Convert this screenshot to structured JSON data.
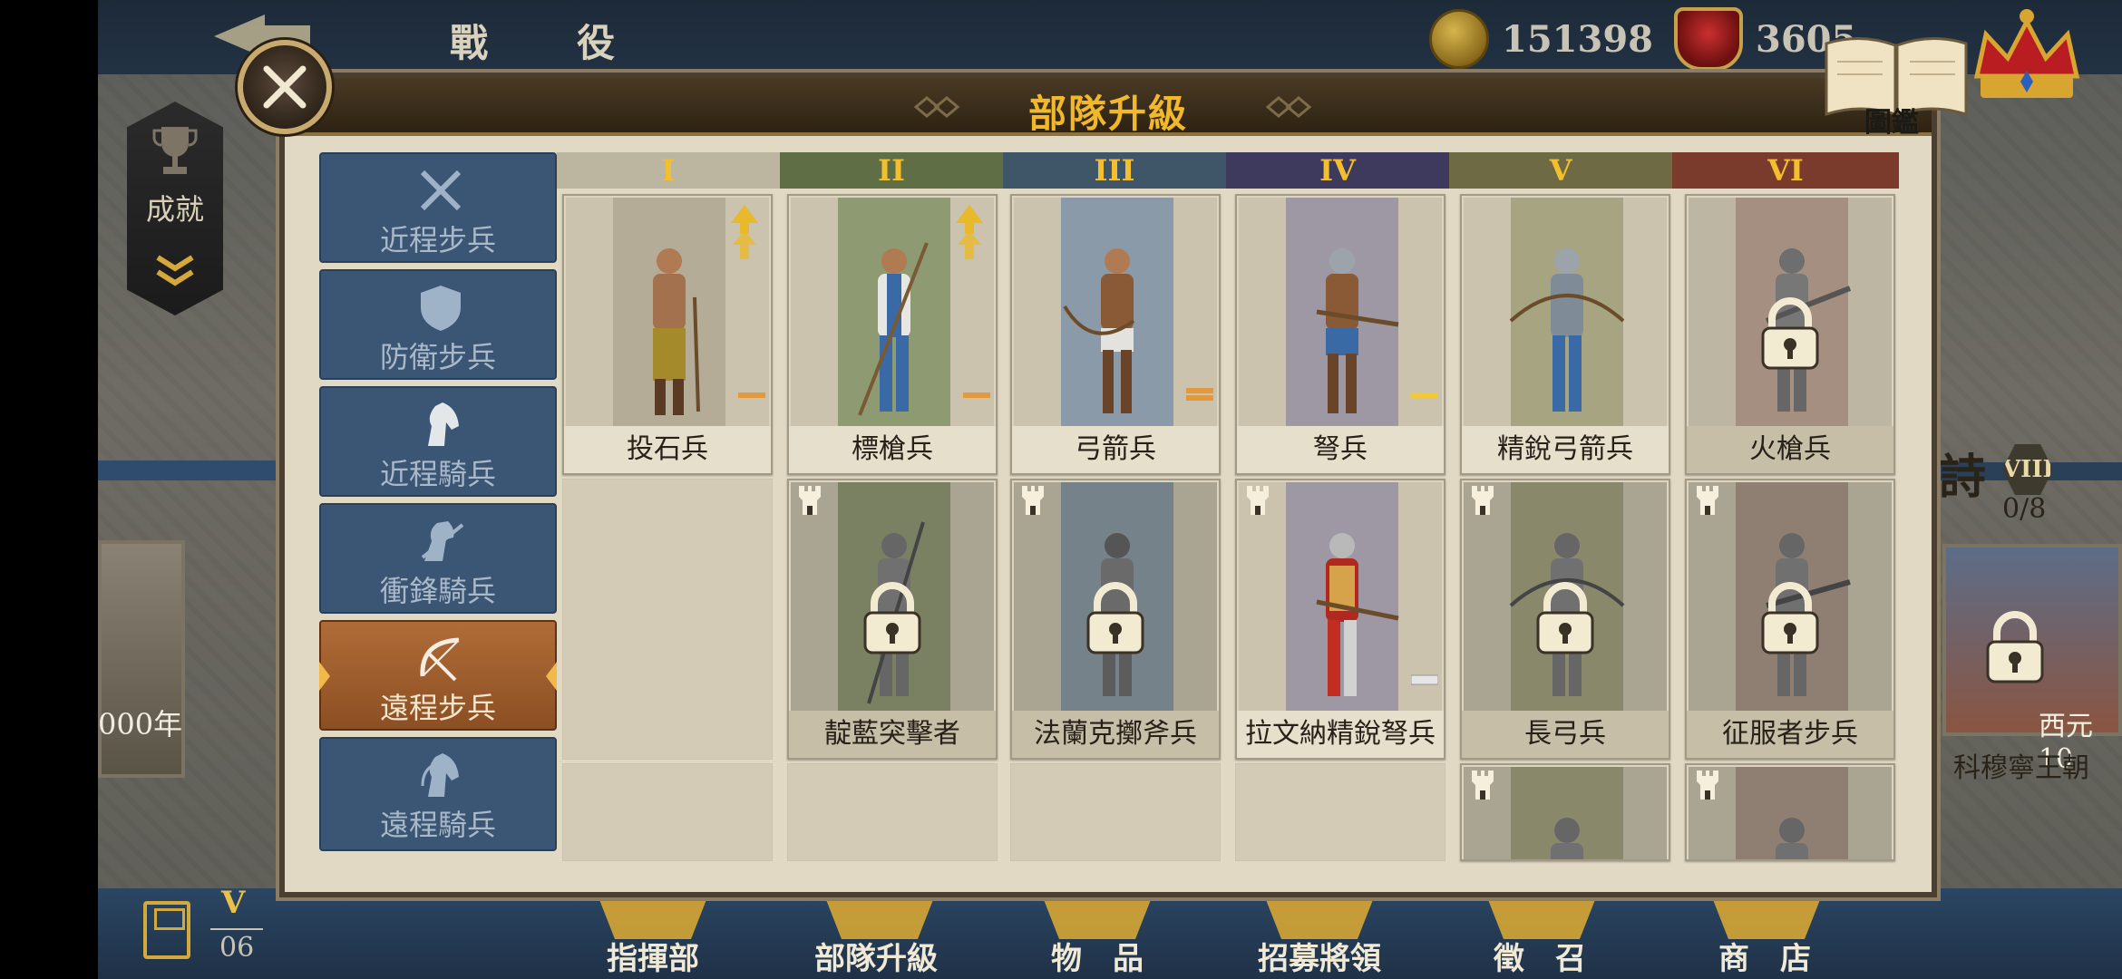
{
  "top": {
    "title": "戰　役",
    "gold": "151398",
    "medals": "3605"
  },
  "sidebar_left": {
    "achievements_label": "成就",
    "year_text": "000年"
  },
  "right_side": {
    "big_char": "詩",
    "tier_badge": "VIII",
    "progress": "0/8",
    "year_text": "西元10",
    "dynasty": "科穆寧王朝"
  },
  "dialog": {
    "title": "部隊升級",
    "codex_label": "圖鑑"
  },
  "categories": [
    {
      "label": "近程步兵",
      "icon": "crossed-swords-icon"
    },
    {
      "label": "防衛步兵",
      "icon": "shield-icon"
    },
    {
      "label": "近程騎兵",
      "icon": "horse-head-icon"
    },
    {
      "label": "衝鋒騎兵",
      "icon": "charging-horse-icon"
    },
    {
      "label": "遠程步兵",
      "icon": "bow-icon",
      "active": true
    },
    {
      "label": "遠程騎兵",
      "icon": "horse-archer-icon"
    }
  ],
  "tiers": [
    {
      "label": "I",
      "color": "#bcb59f"
    },
    {
      "label": "II",
      "color": "#5f6e45"
    },
    {
      "label": "III",
      "color": "#3f5668"
    },
    {
      "label": "IV",
      "color": "#3e3a5e"
    },
    {
      "label": "V",
      "color": "#6e6a43"
    },
    {
      "label": "VI",
      "color": "#7a3b2c"
    }
  ],
  "units": {
    "row1": [
      {
        "name": "投石兵",
        "upgrade": true,
        "tag": "single"
      },
      {
        "name": "標槍兵",
        "upgrade": true,
        "tag": "single"
      },
      {
        "name": "弓箭兵",
        "tag": "double"
      },
      {
        "name": "弩兵",
        "tag": "single-yellow"
      },
      {
        "name": "精銳弓箭兵"
      },
      {
        "name": "火槍兵",
        "locked": true
      }
    ],
    "row2": [
      {
        "name": "靛藍突擊者",
        "locked": true
      },
      {
        "name": "法蘭克擲斧兵",
        "locked": true
      },
      {
        "name": "拉文納精銳弩兵",
        "tag": "gray"
      },
      {
        "name": "長弓兵",
        "locked": true
      },
      {
        "name": "征服者步兵",
        "locked": true
      }
    ]
  },
  "bottom_nav": {
    "save_roman": "V",
    "save_num": "06",
    "items": [
      "指揮部",
      "部隊升級",
      "物　品",
      "招募將領",
      "徵　召",
      "商　店"
    ]
  }
}
